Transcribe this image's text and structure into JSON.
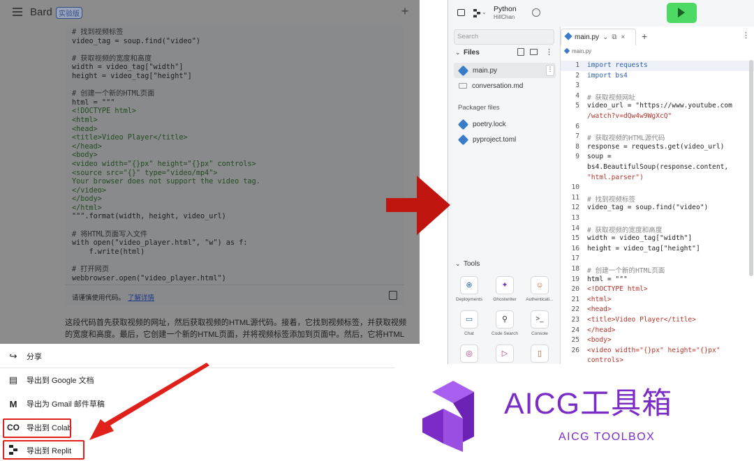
{
  "bard": {
    "title": "Bard",
    "badge": "实验版",
    "code_lines": [
      {
        "t": "# 找到视频标签",
        "k": "cmt"
      },
      {
        "t": "video_tag = soup.find(\"video\")",
        "k": "code"
      },
      {
        "t": "",
        "k": "code"
      },
      {
        "t": "# 获取视频的宽度和高度",
        "k": "cmt"
      },
      {
        "t": "width = video_tag[\"width\"]",
        "k": "code"
      },
      {
        "t": "height = video_tag[\"height\"]",
        "k": "code"
      },
      {
        "t": "",
        "k": "code"
      },
      {
        "t": "# 创建一个新的HTML页面",
        "k": "cmt"
      },
      {
        "t": "html = \"\"\"",
        "k": "code"
      },
      {
        "t": "<!DOCTYPE html>",
        "k": "str"
      },
      {
        "t": "<html>",
        "k": "str"
      },
      {
        "t": "<head>",
        "k": "str"
      },
      {
        "t": "<title>Video Player</title>",
        "k": "str"
      },
      {
        "t": "</head>",
        "k": "str"
      },
      {
        "t": "<body>",
        "k": "str"
      },
      {
        "t": "<video width=\"{}px\" height=\"{}px\" controls>",
        "k": "str"
      },
      {
        "t": "<source src=\"{}\" type=\"video/mp4\">",
        "k": "str"
      },
      {
        "t": "Your browser does not support the video tag.",
        "k": "str"
      },
      {
        "t": "</video>",
        "k": "str"
      },
      {
        "t": "</body>",
        "k": "str"
      },
      {
        "t": "</html>",
        "k": "str"
      },
      {
        "t": "\"\"\".format(width, height, video_url)",
        "k": "code"
      },
      {
        "t": "",
        "k": "code"
      },
      {
        "t": "# 将HTML页面写入文件",
        "k": "cmt"
      },
      {
        "t": "with open(\"video_player.html\", \"w\") as f:",
        "k": "code"
      },
      {
        "t": "    f.write(html)",
        "k": "code"
      },
      {
        "t": "",
        "k": "code"
      },
      {
        "t": "# 打开网页",
        "k": "cmt"
      },
      {
        "t": "webbrowser.open(\"video_player.html\")",
        "k": "code"
      }
    ],
    "footer_notice": "请谨慎使用代码。",
    "footer_link": "了解详情",
    "paragraph": "这段代码首先获取视频的网址，然后获取视频的HTML源代码。接着，它找到视频标签，并获取视频的宽度和高度。最后，它创建一个新的HTML页面，并将视频标签添加到页面中。然后，它将HTML"
  },
  "share_menu": [
    {
      "label": "分享",
      "icon": "share-icon"
    },
    {
      "label": "导出到 Google 文档",
      "icon": "google-docs-icon"
    },
    {
      "label": "导出为 Gmail 邮件草稿",
      "icon": "gmail-icon"
    },
    {
      "label": "导出到 Colab",
      "icon": "colab-icon"
    },
    {
      "label": "导出到 Replit",
      "icon": "replit-icon"
    }
  ],
  "replit": {
    "language": "Python",
    "user": "HillChan",
    "search_placeholder": "Search",
    "files_label": "Files",
    "files": [
      "main.py",
      "conversation.md"
    ],
    "packager_label": "Packager files",
    "packager_files": [
      "poetry.lock",
      "pyproject.toml"
    ],
    "tools_label": "Tools",
    "tools": [
      {
        "label": "Deployments",
        "icon": "deployments-icon"
      },
      {
        "label": "Ghostwriter",
        "icon": "ghostwriter-icon"
      },
      {
        "label": "Authenticati...",
        "icon": "user-icon"
      },
      {
        "label": "Chat",
        "icon": "chat-icon"
      },
      {
        "label": "Code Search",
        "icon": "search-icon"
      },
      {
        "label": "Console",
        "icon": "console-icon"
      },
      {
        "label": "",
        "icon": "database-icon"
      },
      {
        "label": "",
        "icon": "debugger-icon"
      },
      {
        "label": "",
        "icon": "docs-icon"
      }
    ],
    "tab_label": "main.py",
    "breadcrumb": "main.py",
    "editor_lines": [
      "import requests",
      "import bs4",
      "",
      "# 获取视频网址",
      "video_url = \"https://www.youtube.com",
      "/watch?v=dQw4w9WgXcQ\"",
      "",
      "# 获取视频的HTML源代码",
      "response = requests.get(video_url)",
      "soup =",
      "bs4.BeautifulSoup(response.content,",
      "\"html.parser\")",
      "",
      "# 找到视频标签",
      "video_tag = soup.find(\"video\")",
      "",
      "# 获取视频的宽度和高度",
      "width = video_tag[\"width\"]",
      "height = video_tag[\"height\"]",
      "",
      "# 创建一个新的HTML页面",
      "html = \"\"\"",
      "<!DOCTYPE html>",
      "<html>",
      "<head>",
      "<title>Video Player</title>",
      "</head>",
      "<body>",
      "<video width=\"{}px\" height=\"{}px\"",
      "controls>"
    ],
    "editor_line_numbers": [
      "1",
      "2",
      "3",
      "4",
      "5",
      "",
      "6",
      "7",
      "8",
      "9",
      "",
      "",
      "10",
      "11",
      "12",
      "13",
      "14",
      "15",
      "16",
      "17",
      "18",
      "19",
      "20",
      "21",
      "22",
      "23",
      "24",
      "25",
      "26",
      ""
    ]
  },
  "watermark": {
    "title": "AICG工具箱",
    "subtitle": "AICG TOOLBOX",
    "color": "#7b2cc7"
  },
  "colors": {
    "run_button": "#4cd964",
    "highlight_red": "#e0201a",
    "arrow_red": "#c0140f"
  }
}
